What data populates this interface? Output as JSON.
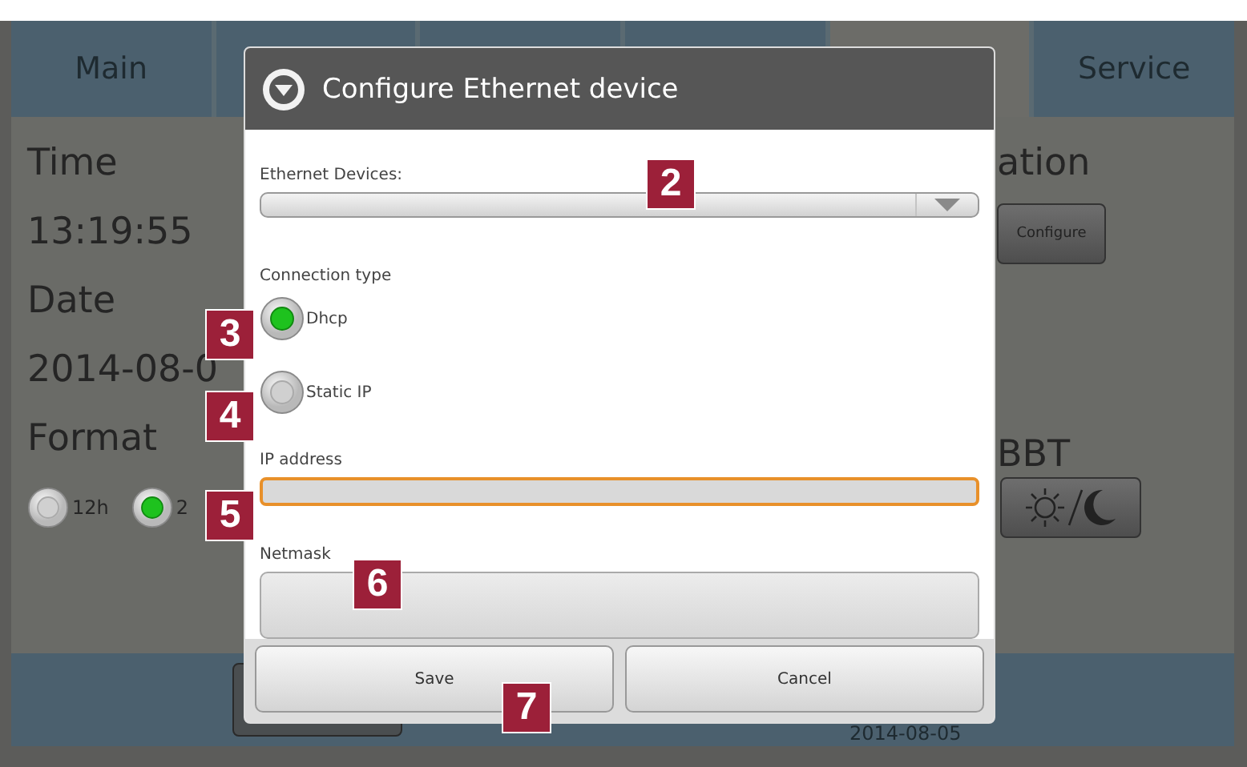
{
  "tabs": [
    {
      "label": "Main",
      "selected": false
    },
    {
      "selected": false
    },
    {
      "selected": false
    },
    {
      "selected": false
    },
    {
      "selected": true
    },
    {
      "label": "Service",
      "selected": false
    }
  ],
  "left_panel": {
    "time_label": "Time",
    "time": "13:19:55",
    "date_label": "Date",
    "date": "2014-08-0",
    "format_label": "Format",
    "format_options": [
      {
        "label": "12h",
        "selected": false
      },
      {
        "label": "2",
        "selected": true
      }
    ]
  },
  "right_panel": {
    "heading": "ation",
    "configure_button": "Configure",
    "bbt_label": "BBT"
  },
  "bottom_bar": {
    "date": "2014-08-05"
  },
  "dialog": {
    "title": "Configure Ethernet device",
    "devices_label": "Ethernet Devices:",
    "connection_label": "Connection type",
    "connection_options": [
      {
        "label": "Dhcp",
        "selected": true
      },
      {
        "label": "Static IP",
        "selected": false
      }
    ],
    "ip_label": "IP address",
    "ip_focused": true,
    "netmask_label": "Netmask",
    "buttons": [
      "Save",
      "Cancel"
    ]
  },
  "callouts": [
    {
      "label": "2"
    },
    {
      "label": "3"
    },
    {
      "label": "4"
    },
    {
      "label": "5"
    },
    {
      "label": "6"
    },
    {
      "label": "7"
    }
  ]
}
